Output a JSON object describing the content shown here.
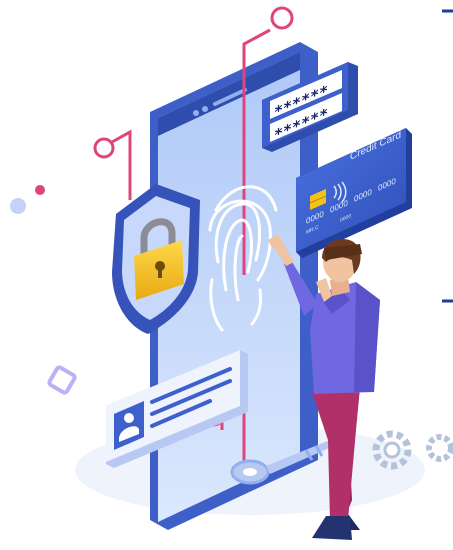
{
  "password_card": {
    "line1": "******",
    "line2": "******"
  },
  "credit_card": {
    "title": "Credit Card",
    "number_groups": [
      "0000",
      "0000",
      "0000",
      "0000"
    ],
    "name_short": "MR.C",
    "expiry_short": "0000"
  },
  "colors": {
    "phone_body": "#5c7fe6",
    "phone_screen": "#c9dcfb",
    "lock_gold": "#f3c318",
    "wire_pink": "#e0447c",
    "card_blue": "#3a5fd0",
    "person_shirt": "#6f68e0",
    "person_pants": "#b2306a"
  },
  "icons": [
    "fingerprint-icon",
    "padlock-icon",
    "shield-icon",
    "key-icon",
    "gear-icon",
    "user-avatar-icon",
    "credit-card-chip-icon",
    "contactless-icon"
  ]
}
